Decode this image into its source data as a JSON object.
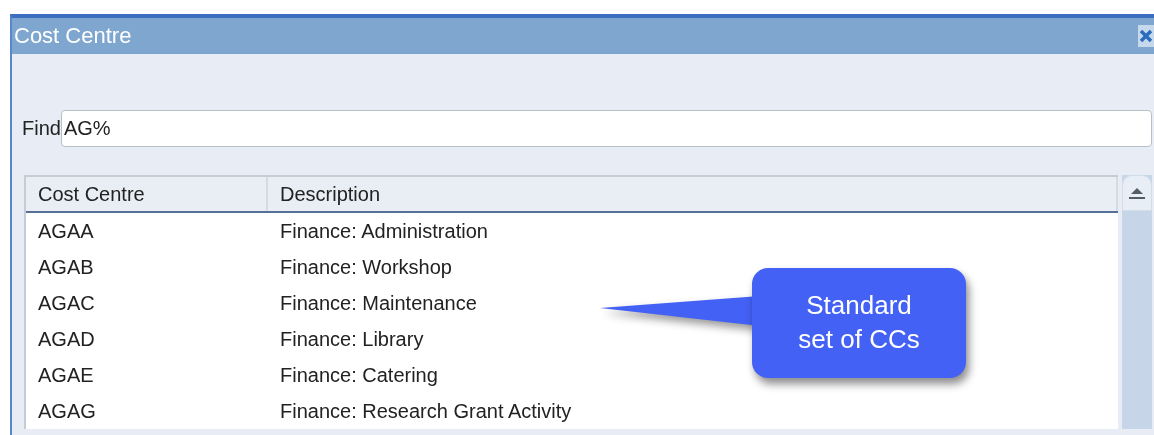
{
  "window": {
    "title": "Cost Centre"
  },
  "find": {
    "label": "Find",
    "value": "AG%"
  },
  "table": {
    "columns": [
      "Cost Centre",
      "Description"
    ],
    "rows": [
      {
        "code": "AGAA",
        "description": "Finance: Administration"
      },
      {
        "code": "AGAB",
        "description": "Finance: Workshop"
      },
      {
        "code": "AGAC",
        "description": "Finance: Maintenance"
      },
      {
        "code": "AGAD",
        "description": "Finance: Library"
      },
      {
        "code": "AGAE",
        "description": "Finance: Catering"
      },
      {
        "code": "AGAG",
        "description": "Finance: Research Grant Activity"
      }
    ]
  },
  "callout": {
    "text": "Standard set of CCs"
  }
}
